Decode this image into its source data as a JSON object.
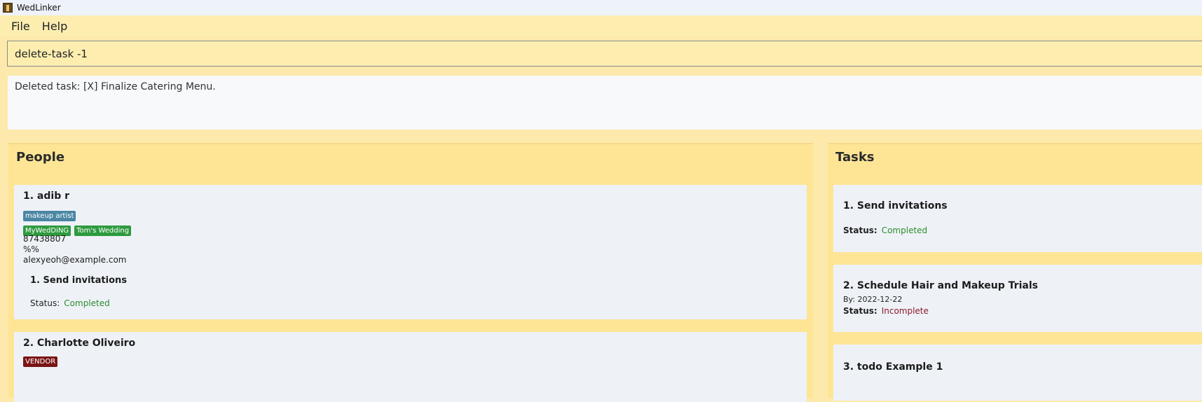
{
  "window": {
    "title": "WedLinker"
  },
  "menu": {
    "file": "File",
    "help": "Help"
  },
  "command": {
    "value": "delete-task -1"
  },
  "result": {
    "text": "Deleted task: [X] Finalize Catering Menu."
  },
  "people": {
    "title": "People",
    "items": [
      {
        "name": "1. adib r",
        "role_tag": "makeup artist",
        "wedding_tags": [
          "MyWedDiNG",
          "Tom's Wedding"
        ],
        "phone": "87438807",
        "address": "%%",
        "email": "alexyeoh@example.com",
        "task": {
          "name": "1. Send invitations",
          "status_label": "Status:",
          "status": "Completed"
        }
      },
      {
        "name": "2. Charlotte Oliveiro",
        "role_tag": "VENDOR"
      }
    ]
  },
  "tasks": {
    "title": "Tasks",
    "items": [
      {
        "name": "1. Send invitations",
        "status_label": "Status:",
        "status": "Completed"
      },
      {
        "name": "2. Schedule Hair and Makeup Trials",
        "by": "By: 2022-12-22",
        "status_label": "Status:",
        "status": "Incomplete"
      },
      {
        "name": "3. todo Example 1"
      }
    ]
  },
  "colors": {
    "background": "#fde9ab",
    "panel": "#fde595",
    "card": "#eef2f7",
    "completed": "#2e8b2e",
    "incomplete": "#8b1a2b",
    "tag_role": "#4b86a4",
    "tag_wedding": "#2e9a3e",
    "tag_vendor": "#7a1515"
  }
}
